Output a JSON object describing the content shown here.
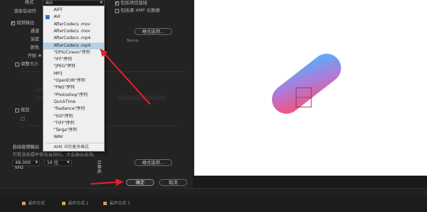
{
  "format_row": {
    "label": "格式",
    "value": "AVI"
  },
  "preset_row": {
    "label": "渲染后动作"
  },
  "video_output": {
    "label": "视频输出"
  },
  "video_fields": [
    {
      "label": "通道"
    },
    {
      "label": "深度"
    },
    {
      "label": "颜色"
    },
    {
      "label": "开始 #"
    }
  ],
  "format_options_button": "格式选项...",
  "none_text": "None",
  "resize_label": "调整大小",
  "crop_label": "裁剪",
  "top_right_checks": [
    {
      "label": "包括项目链接",
      "checked": true
    },
    {
      "label": "包括源 XMP 元数据",
      "checked": false
    }
  ],
  "dropdown_items": [
    {
      "label": "AIFF",
      "checked": false,
      "highlighted": false
    },
    {
      "label": "AVI",
      "checked": true,
      "highlighted": false
    },
    {
      "label": "AfterCodecs .mov",
      "checked": false,
      "highlighted": false
    },
    {
      "label": "AfterCodecs .mov",
      "checked": false,
      "highlighted": false
    },
    {
      "label": "AfterCodecs .mp4",
      "checked": false,
      "highlighted": false
    },
    {
      "label": "AfterCodecs .mp4",
      "checked": false,
      "highlighted": true
    },
    {
      "label": "\"DPX/Cineon\"序列",
      "checked": false,
      "highlighted": false
    },
    {
      "label": "\"IFF\"序列",
      "checked": false,
      "highlighted": false
    },
    {
      "label": "\"JPEG\"序列",
      "checked": false,
      "highlighted": false
    },
    {
      "label": "MP3",
      "checked": false,
      "highlighted": false
    },
    {
      "label": "\"OpenEXR\"序列",
      "checked": false,
      "highlighted": false
    },
    {
      "label": "\"PNG\"序列",
      "checked": false,
      "highlighted": false
    },
    {
      "label": "\"Photoshop\"序列",
      "checked": false,
      "highlighted": false
    },
    {
      "label": "QuickTime",
      "checked": false,
      "highlighted": false
    },
    {
      "label": "\"Radiance\"序列",
      "checked": false,
      "highlighted": false
    },
    {
      "label": "\"SGI\"序列",
      "checked": false,
      "highlighted": false
    },
    {
      "label": "\"TIFF\"序列",
      "checked": false,
      "highlighted": false
    },
    {
      "label": "\"Targa\"序列",
      "checked": false,
      "highlighted": false
    },
    {
      "label": "WAV",
      "checked": false,
      "highlighted": false
    }
  ],
  "dropdown_footer": "AME 中的更多格式",
  "audio_output": {
    "label": "自动音频输出",
    "note": "只有当合成中含有音频时，才会输出音频。"
  },
  "audio_settings": {
    "sample_rate": "48.000 kHz",
    "bit_depth": "16 位",
    "channels": "立体声"
  },
  "audio_format_button": "格式选项...",
  "ok_button": "确定",
  "cancel_button": "取消",
  "timeline_tabs": [
    "最终合成",
    "最终合成 2",
    "最终合成 3"
  ],
  "colors": {
    "shape_gradient_start": "#ff4d6d",
    "shape_gradient_mid": "#b07ad8",
    "shape_gradient_end": "#4fb4ff",
    "arrow": "#e0202a"
  }
}
